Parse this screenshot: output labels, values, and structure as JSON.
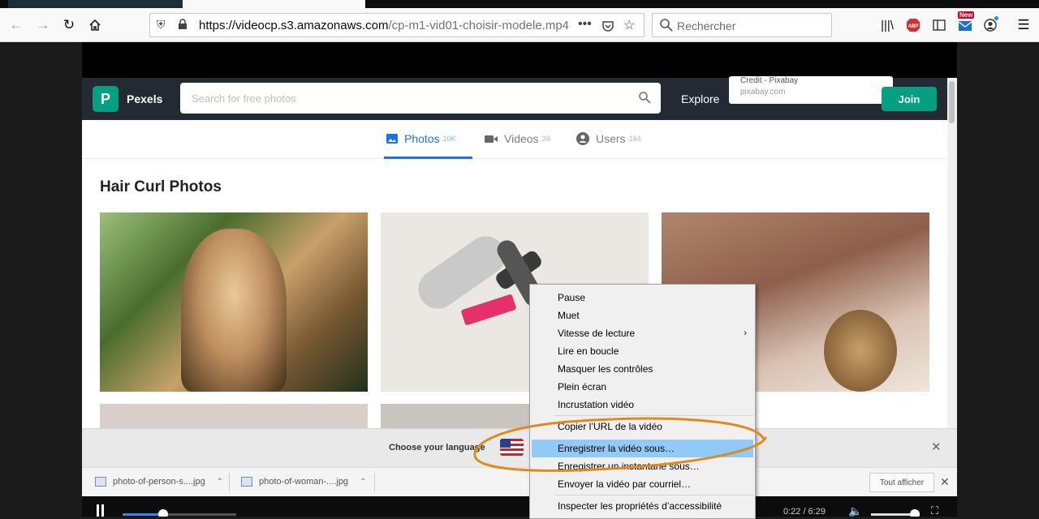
{
  "browser": {
    "url_host": "https://videocp.s3.amazonaws.com",
    "url_path": "/cp-m1-vid01-choisir-modele.mp4",
    "search_placeholder": "Rechercher",
    "new_badge": "New",
    "abp_label": "ABP"
  },
  "pexels": {
    "brand": "Pexels",
    "logo_letter": "P",
    "search_placeholder": "Search for free photos",
    "explore": "Explore",
    "popup_line1": "Credit - Pixabay",
    "popup_line2": "pixabay.com",
    "join": "Join",
    "tabs": [
      {
        "label": "Photos",
        "count": "10K"
      },
      {
        "label": "Videos",
        "count": "38"
      },
      {
        "label": "Users",
        "count": "184"
      }
    ],
    "page_title": "Hair Curl Photos"
  },
  "language_bar": {
    "text": "Choose your language"
  },
  "downloads": {
    "items": [
      "photo-of-person-s....jpg",
      "photo-of-woman-....jpg"
    ],
    "show_all": "Tout afficher"
  },
  "video_controls": {
    "time": "0:22 / 6:29",
    "progress": 0.06,
    "volume": 0.8
  },
  "context_menu": {
    "items": [
      {
        "label": "Pause",
        "submenu": false
      },
      {
        "label": "Muet",
        "submenu": false
      },
      {
        "label": "Vitesse de lecture",
        "submenu": true
      },
      {
        "label": "Lire en boucle",
        "submenu": false
      },
      {
        "label": "Masquer les contrôles",
        "submenu": false
      },
      {
        "label": "Plein écran",
        "submenu": false
      },
      {
        "label": "Incrustation vidéo",
        "submenu": false
      },
      {
        "label": "Copier l’URL de la vidéo",
        "submenu": false
      },
      {
        "label": "Enregistrer la vidéo sous…",
        "submenu": false,
        "highlighted": true
      },
      {
        "label": "Enregistrer un instantané sous…",
        "submenu": false
      },
      {
        "label": "Envoyer la vidéo par courriel…",
        "submenu": false
      },
      {
        "label": "Inspecter les propriétés d’accessibilité",
        "submenu": false
      }
    ]
  },
  "colors": {
    "highlight": "#91c9f7",
    "annotation_ring": "#e08a1e",
    "pexels_green": "#05a081"
  }
}
